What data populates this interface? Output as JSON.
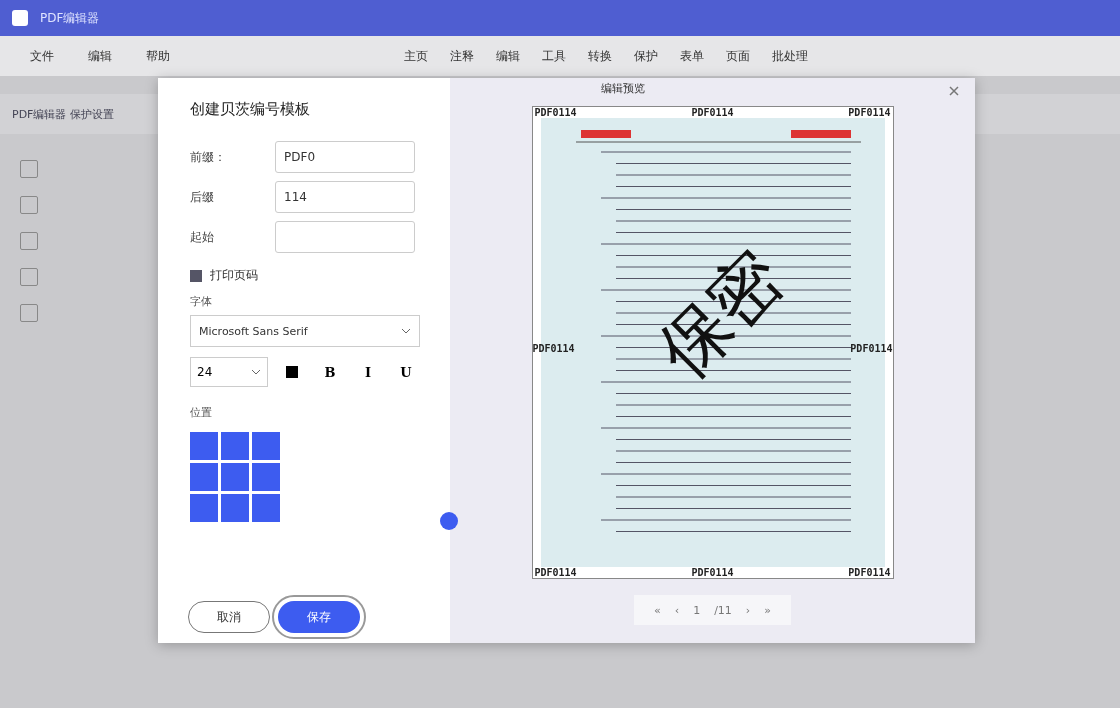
{
  "app": {
    "title": "PDF编辑器",
    "menu": [
      "文件",
      "编辑",
      "帮助"
    ],
    "toolbar": [
      "主页",
      "注释",
      "编辑",
      "工具",
      "转换",
      "保护",
      "表单",
      "页面",
      "批处理"
    ],
    "breadcrumb": "PDF编辑器 保护设置"
  },
  "dialog": {
    "title": "创建贝茨编号模板",
    "fields": [
      {
        "label": "前缀：",
        "value": "PDF0"
      },
      {
        "label": "后缀",
        "value": "114"
      },
      {
        "label": "起始"
      }
    ],
    "checkbox": {
      "label": "打印页码",
      "checked": true
    },
    "font_label": "字体",
    "font": "Microsoft Sans Serif",
    "size": "24",
    "format_buttons": [
      {
        "kind": "color"
      },
      {
        "kind": "text",
        "label": "B"
      },
      {
        "kind": "text",
        "label": "I"
      },
      {
        "kind": "text",
        "label": "U"
      }
    ],
    "position_label": "位置",
    "buttons": [
      {
        "label": "取消",
        "kind": "secondary"
      },
      {
        "label": "保存",
        "kind": "primary"
      }
    ]
  },
  "preview": {
    "title": "编辑预览",
    "header": [
      "PDF0114",
      "PDF0114",
      "PDF0114"
    ],
    "middle": [
      "PDF0114",
      "PDF0114"
    ],
    "footer": [
      "PDF0114",
      "PDF0114",
      "PDF0114"
    ],
    "watermark": "保密",
    "pager": [
      "«",
      "‹",
      "1",
      "/11",
      "›",
      "»"
    ]
  }
}
